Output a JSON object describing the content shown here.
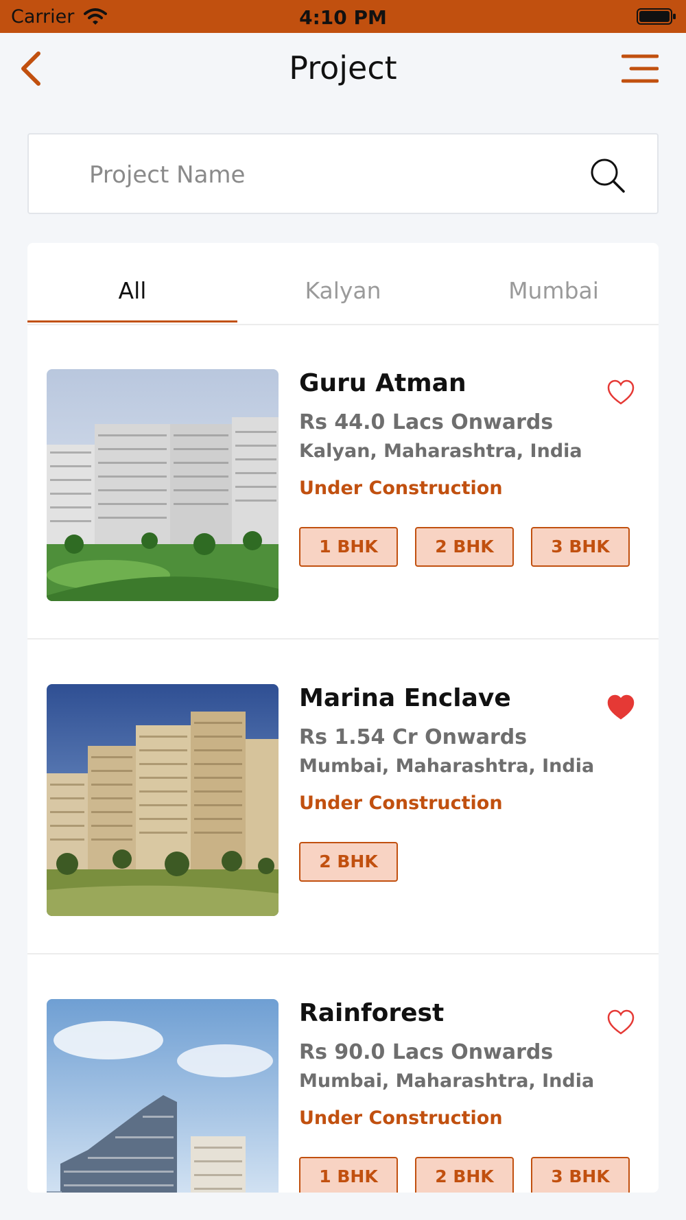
{
  "status_bar": {
    "carrier": "Carrier",
    "time": "4:10 PM"
  },
  "nav": {
    "title": "Project"
  },
  "search": {
    "placeholder": "Project Name",
    "value": ""
  },
  "tabs": [
    {
      "label": "All",
      "active": true
    },
    {
      "label": "Kalyan",
      "active": false
    },
    {
      "label": "Mumbai",
      "active": false
    }
  ],
  "projects": [
    {
      "name": "Guru Atman",
      "price": "Rs 44.0 Lacs Onwards",
      "location": "Kalyan, Maharashtra, India",
      "status": "Under Construction",
      "favorite": false,
      "configs": [
        "1 BHK",
        "2 BHK",
        "3 BHK"
      ]
    },
    {
      "name": "Marina Enclave",
      "price": "Rs 1.54 Cr Onwards",
      "location": "Mumbai, Maharashtra, India",
      "status": "Under Construction",
      "favorite": true,
      "configs": [
        "2 BHK"
      ]
    },
    {
      "name": "Rainforest",
      "price": "Rs 90.0 Lacs Onwards",
      "location": "Mumbai, Maharashtra, India",
      "status": "Under Construction",
      "favorite": false,
      "configs": [
        "1 BHK",
        "2 BHK",
        "3 BHK"
      ]
    }
  ],
  "colors": {
    "accent": "#c1500f",
    "chip_bg": "#f8d3c3",
    "favorite": "#e53935"
  },
  "icons": [
    "wifi-icon",
    "battery-icon",
    "back-icon",
    "menu-icon",
    "search-icon",
    "heart-outline-icon",
    "heart-filled-icon"
  ]
}
